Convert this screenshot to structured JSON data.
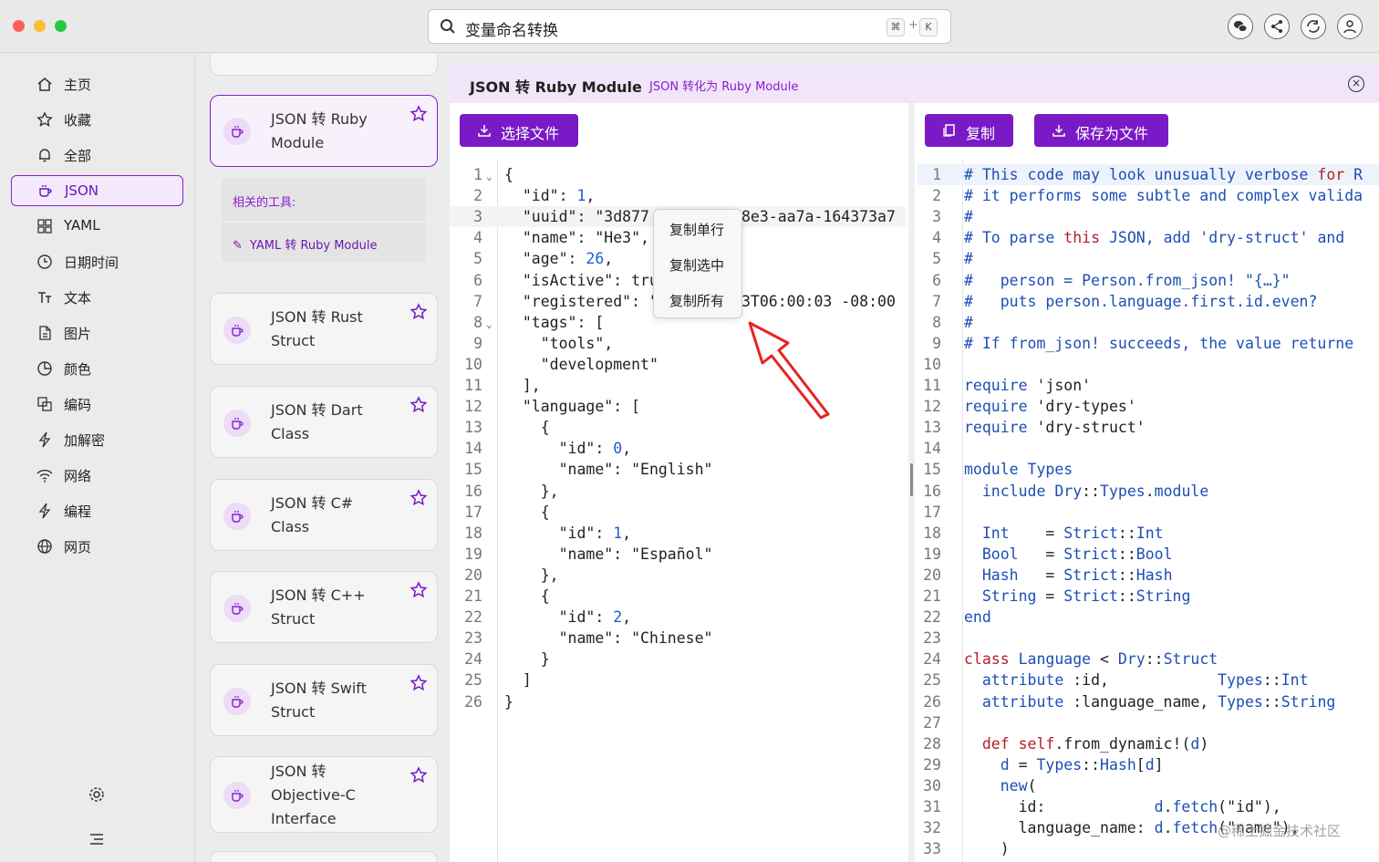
{
  "search": {
    "query": "变量命名转换",
    "kbd1": "⌘",
    "kbd_plus": "+",
    "kbd2": "K"
  },
  "toolbar_icons": [
    "wechat-icon",
    "share-icon",
    "sync-icon",
    "user-icon"
  ],
  "sidebar": {
    "items": [
      {
        "label": "主页",
        "icon": "home-icon"
      },
      {
        "label": "收藏",
        "icon": "star-icon"
      },
      {
        "label": "全部",
        "icon": "bell-icon"
      },
      {
        "label": "JSON",
        "icon": "cup-icon",
        "active": true
      },
      {
        "label": "YAML",
        "icon": "grid-icon"
      },
      {
        "label": "日期时间",
        "icon": "clock-icon"
      },
      {
        "label": "文本",
        "icon": "text-icon"
      },
      {
        "label": "图片",
        "icon": "image-icon"
      },
      {
        "label": "颜色",
        "icon": "color-icon"
      },
      {
        "label": "编码",
        "icon": "encode-icon"
      },
      {
        "label": "加解密",
        "icon": "bolt-icon"
      },
      {
        "label": "网络",
        "icon": "wifi-icon"
      },
      {
        "label": "编程",
        "icon": "bolt-icon"
      },
      {
        "label": "网页",
        "icon": "globe-icon"
      }
    ]
  },
  "tools": [
    {
      "title": "JSON 转 Ruby Module",
      "line1": "JSON 转 Ruby",
      "line2": "Module"
    },
    {
      "line1": "JSON 转 Rust",
      "line2": "Struct"
    },
    {
      "line1": "JSON 转 Dart",
      "line2": "Class"
    },
    {
      "line1": "JSON 转 C#",
      "line2": "Class"
    },
    {
      "line1": "JSON 转 C++",
      "line2": "Struct"
    },
    {
      "line1": "JSON 转 Swift",
      "line2": "Struct"
    },
    {
      "line1": "JSON 转",
      "line2": "Objective-C",
      "line3": "Interface"
    }
  ],
  "related": {
    "heading": "相关的工具:",
    "item": "YAML 转 Ruby Module"
  },
  "main": {
    "title": "JSON 转 Ruby Module",
    "subtitle": "JSON 转化为 Ruby Module",
    "choose_file": "选择文件",
    "copy": "复制",
    "save_file": "保存为文件"
  },
  "context_menu": [
    "复制单行",
    "复制选中",
    "复制所有"
  ],
  "input_lines": [
    "{",
    "  \"id\": 1,",
    "  \"uuid\": \"3d877",
    "  \"name\": \"He3\",",
    "  \"age\": 26,",
    "  \"isActive\": tru",
    "  \"registered\": \"",
    "  \"tags\": [",
    "    \"tools\",",
    "    \"development\"",
    "  ],",
    "  \"language\": [",
    "    {",
    "      \"id\": 0,",
    "      \"name\": \"English\"",
    "    },",
    "    {",
    "      \"id\": 1,",
    "      \"name\": \"Español\"",
    "    },",
    "    {",
    "      \"id\": 2,",
    "      \"name\": \"Chinese\"",
    "    }",
    "  ]",
    "}"
  ],
  "input_hidden_fragments": {
    "uuid_tail": "8e3-aa7a-164373a7",
    "registered_tail": "3T06:00:03 -08:00"
  },
  "output_lines": [
    "# This code may look unusually verbose for R",
    "# it performs some subtle and complex valida",
    "#",
    "# To parse this JSON, add 'dry-struct' and",
    "#",
    "#   person = Person.from_json! \"{…}\"",
    "#   puts person.language.first.id.even?",
    "#",
    "# If from_json! succeeds, the value returne",
    "",
    "require 'json'",
    "require 'dry-types'",
    "require 'dry-struct'",
    "",
    "module Types",
    "  include Dry::Types.module",
    "",
    "  Int    = Strict::Int",
    "  Bool   = Strict::Bool",
    "  Hash   = Strict::Hash",
    "  String = Strict::String",
    "end",
    "",
    "class Language < Dry::Struct",
    "  attribute :id,            Types::Int",
    "  attribute :language_name, Types::String",
    "",
    "  def self.from_dynamic!(d)",
    "    d = Types::Hash[d]",
    "    new(",
    "      id:            d.fetch(\"id\"),",
    "      language_name: d.fetch(\"name\"),",
    "    )"
  ],
  "watermark": "@稀土掘金技术社区",
  "colors": {
    "accent": "#7a1ac6",
    "header_bg": "#f1e5f9"
  }
}
